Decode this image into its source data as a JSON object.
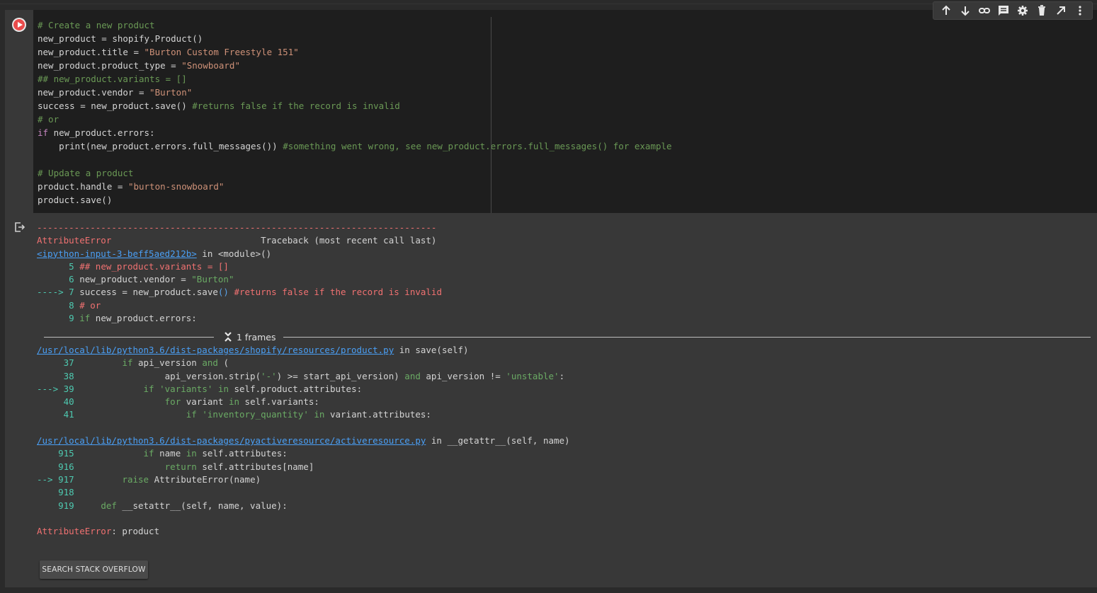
{
  "toolbar": {
    "icons": [
      "arrow-up-icon",
      "arrow-down-icon",
      "link-icon",
      "comment-icon",
      "gear-icon",
      "trash-icon",
      "open-external-icon",
      "more-vert-icon"
    ]
  },
  "code": {
    "lines": [
      "# Create a new product",
      "new_product = shopify.Product()",
      "new_product.title = \"Burton Custom Freestyle 151\"",
      "new_product.product_type = \"Snowboard\"",
      "## new_product.variants = []",
      "new_product.vendor = \"Burton\"",
      "success = new_product.save() #returns false if the record is invalid",
      "# or",
      "if new_product.errors:",
      "    print(new_product.errors.full_messages()) #something went wrong, see new_product.errors.full_messages() for example",
      "",
      "# Update a product",
      "product.handle = \"burton-snowboard\"",
      "product.save()"
    ]
  },
  "traceback": {
    "dashes": "---------------------------------------------------------------------------",
    "error_name": "AttributeError",
    "traceback_header": "Traceback (most recent call last)",
    "input_link": "<ipython-input-3-beff5aed212b>",
    "input_loc": " in <module>()",
    "frame1": [
      {
        "num": "      5 ",
        "code": "## new_product.variants = []"
      },
      {
        "num": "      6 ",
        "code": "new_product.vendor = \"Burton\""
      },
      {
        "num": "----> 7 ",
        "code": "success = new_product.save() #returns false if the record is invalid"
      },
      {
        "num": "      8 ",
        "code": "# or"
      },
      {
        "num": "      9 ",
        "code": "if new_product.errors:"
      }
    ],
    "frames_label": "1 frames",
    "file1_link": "/usr/local/lib/python3.6/dist-packages/shopify/resources/product.py",
    "file1_loc": " in save(self)",
    "frame2": [
      {
        "num": "     37 ",
        "code": "        if api_version and ("
      },
      {
        "num": "     38 ",
        "code": "                api_version.strip('-') >= start_api_version) and api_version != 'unstable':"
      },
      {
        "num": "---> 39 ",
        "code": "            if 'variants' in self.product.attributes:"
      },
      {
        "num": "     40 ",
        "code": "                for variant in self.variants:"
      },
      {
        "num": "     41 ",
        "code": "                    if 'inventory_quantity' in variant.attributes:"
      }
    ],
    "file2_link": "/usr/local/lib/python3.6/dist-packages/pyactiveresource/activeresource.py",
    "file2_loc": " in __getattr__(self, name)",
    "frame3": [
      {
        "num": "    915 ",
        "code": "            if name in self.attributes:"
      },
      {
        "num": "    916 ",
        "code": "                return self.attributes[name]"
      },
      {
        "num": "--> 917 ",
        "code": "        raise AttributeError(name)"
      },
      {
        "num": "    918 ",
        "code": ""
      },
      {
        "num": "    919 ",
        "code": "    def __setattr__(self, name, value):"
      }
    ],
    "final_error_name": "AttributeError",
    "final_error_msg": ": product"
  },
  "buttons": {
    "search_so": "SEARCH STACK OVERFLOW"
  }
}
